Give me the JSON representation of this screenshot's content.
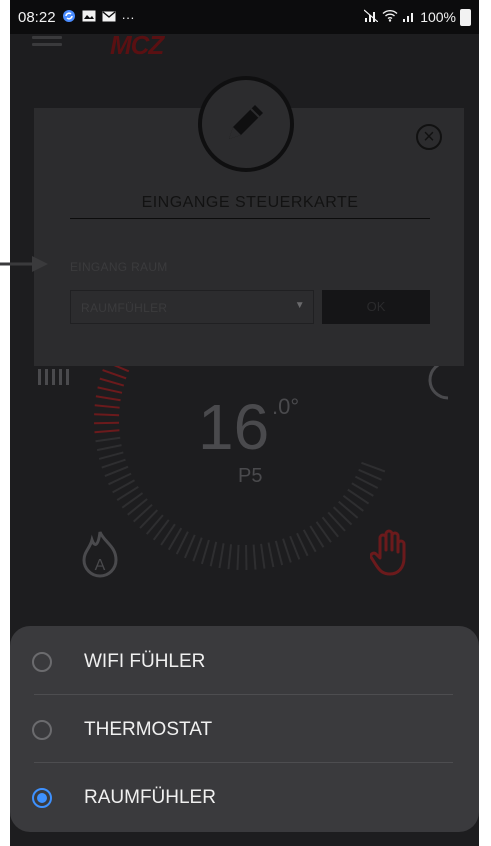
{
  "statusbar": {
    "time": "08:22",
    "notification_icons": [
      "sync-icon",
      "gallery-icon",
      "mail-icon",
      "more-icon"
    ],
    "more": "···",
    "battery": "100%"
  },
  "app": {
    "logo": "MCZ"
  },
  "dial": {
    "temperature": "16",
    "unit": ".0°",
    "power_level": "P5"
  },
  "dialog": {
    "title": "EINGANGE STEUERKARTE",
    "input_label": "EINGANG RAUM",
    "select_value": "RAUMFÜHLER",
    "ok_label": "OK"
  },
  "sheet": {
    "options": [
      {
        "label": "WIFI FÜHLER",
        "selected": false
      },
      {
        "label": "THERMOSTAT",
        "selected": false
      },
      {
        "label": "RAUMFÜHLER",
        "selected": true
      }
    ]
  },
  "colors": {
    "accent": "#3e91ff",
    "sheet_bg": "#3a3a3d",
    "dial_active": "#6b1a1c"
  }
}
